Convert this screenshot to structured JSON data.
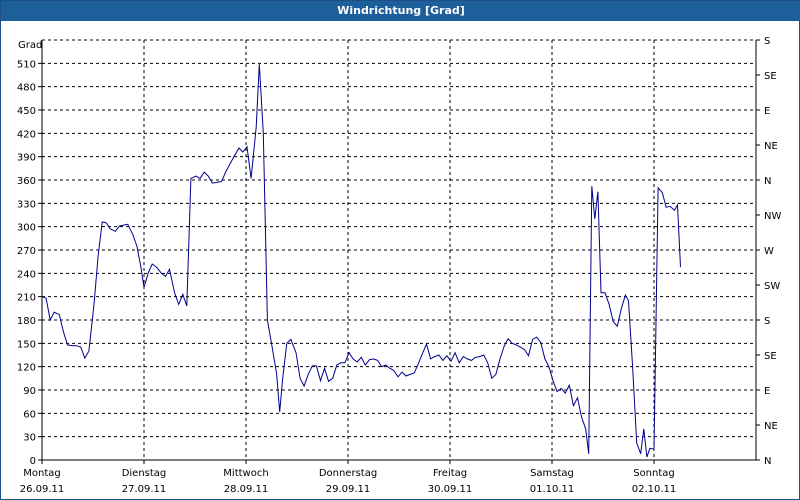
{
  "window": {
    "title": "Windrichtung [Grad]"
  },
  "chart_data": {
    "type": "line",
    "title": "Windrichtung [Grad]",
    "ylabel": "Grad",
    "ylim": [
      0,
      525
    ],
    "yticks": [
      0,
      30,
      60,
      90,
      120,
      150,
      180,
      210,
      240,
      270,
      300,
      330,
      360,
      390,
      420,
      450,
      480,
      510
    ],
    "right_axis_labels": [
      {
        "value": 0,
        "label": "N"
      },
      {
        "value": 45,
        "label": "NE"
      },
      {
        "value": 90,
        "label": "E"
      },
      {
        "value": 135,
        "label": "SE"
      },
      {
        "value": 180,
        "label": "S"
      },
      {
        "value": 225,
        "label": "SW"
      },
      {
        "value": 270,
        "label": "W"
      },
      {
        "value": 315,
        "label": "NW"
      },
      {
        "value": 360,
        "label": "N"
      },
      {
        "value": 405,
        "label": "NE"
      },
      {
        "value": 450,
        "label": "E"
      },
      {
        "value": 495,
        "label": "SE"
      },
      {
        "value": 540,
        "label": "S"
      }
    ],
    "xlim": [
      0,
      7
    ],
    "days": [
      {
        "name": "Montag",
        "date": "26.09.11"
      },
      {
        "name": "Dienstag",
        "date": "27.09.11"
      },
      {
        "name": "Mittwoch",
        "date": "28.09.11"
      },
      {
        "name": "Donnerstag",
        "date": "29.09.11"
      },
      {
        "name": "Freitag",
        "date": "30.09.11"
      },
      {
        "name": "Samstag",
        "date": "01.10.11"
      },
      {
        "name": "Sonntag",
        "date": "02.10.11"
      }
    ],
    "grid": true,
    "line_color": "#00008b",
    "series": [
      {
        "values": [
          [
            0.0,
            210
          ],
          [
            0.04,
            208
          ],
          [
            0.08,
            180
          ],
          [
            0.12,
            190
          ],
          [
            0.17,
            187
          ],
          [
            0.21,
            165
          ],
          [
            0.25,
            148
          ],
          [
            0.3,
            147
          ],
          [
            0.34,
            147
          ],
          [
            0.38,
            145
          ],
          [
            0.42,
            131
          ],
          [
            0.46,
            140
          ],
          [
            0.51,
            200
          ],
          [
            0.55,
            262
          ],
          [
            0.59,
            306
          ],
          [
            0.63,
            305
          ],
          [
            0.67,
            297
          ],
          [
            0.72,
            294
          ],
          [
            0.76,
            301
          ],
          [
            0.8,
            302
          ],
          [
            0.84,
            303
          ],
          [
            0.89,
            290
          ],
          [
            0.93,
            275
          ],
          [
            0.97,
            248
          ],
          [
            1.0,
            222
          ],
          [
            1.04,
            240
          ],
          [
            1.08,
            252
          ],
          [
            1.13,
            247
          ],
          [
            1.17,
            240
          ],
          [
            1.21,
            236
          ],
          [
            1.25,
            245
          ],
          [
            1.3,
            215
          ],
          [
            1.34,
            200
          ],
          [
            1.38,
            213
          ],
          [
            1.42,
            198
          ],
          [
            1.46,
            362
          ],
          [
            1.51,
            365
          ],
          [
            1.55,
            362
          ],
          [
            1.59,
            370
          ],
          [
            1.63,
            365
          ],
          [
            1.67,
            356
          ],
          [
            1.72,
            357
          ],
          [
            1.76,
            358
          ],
          [
            1.8,
            370
          ],
          [
            1.84,
            380
          ],
          [
            1.89,
            392
          ],
          [
            1.93,
            401
          ],
          [
            1.97,
            396
          ],
          [
            2.01,
            403
          ],
          [
            2.05,
            362
          ],
          [
            2.1,
            428
          ],
          [
            2.13,
            509
          ],
          [
            2.17,
            420
          ],
          [
            2.21,
            180
          ],
          [
            2.25,
            150
          ],
          [
            2.3,
            111
          ],
          [
            2.33,
            62
          ],
          [
            2.36,
            105
          ],
          [
            2.4,
            150
          ],
          [
            2.44,
            155
          ],
          [
            2.49,
            138
          ],
          [
            2.53,
            105
          ],
          [
            2.57,
            95
          ],
          [
            2.61,
            110
          ],
          [
            2.65,
            121
          ],
          [
            2.69,
            121
          ],
          [
            2.73,
            102
          ],
          [
            2.77,
            118
          ],
          [
            2.81,
            101
          ],
          [
            2.85,
            105
          ],
          [
            2.89,
            122
          ],
          [
            2.93,
            125
          ],
          [
            2.97,
            125
          ],
          [
            3.01,
            138
          ],
          [
            3.05,
            130
          ],
          [
            3.09,
            126
          ],
          [
            3.13,
            132
          ],
          [
            3.17,
            122
          ],
          [
            3.21,
            129
          ],
          [
            3.25,
            130
          ],
          [
            3.29,
            128
          ],
          [
            3.33,
            120
          ],
          [
            3.37,
            122
          ],
          [
            3.41,
            118
          ],
          [
            3.45,
            115
          ],
          [
            3.49,
            107
          ],
          [
            3.53,
            113
          ],
          [
            3.57,
            108
          ],
          [
            3.61,
            110
          ],
          [
            3.65,
            112
          ],
          [
            3.69,
            124
          ],
          [
            3.73,
            137
          ],
          [
            3.77,
            149
          ],
          [
            3.81,
            130
          ],
          [
            3.85,
            133
          ],
          [
            3.89,
            135
          ],
          [
            3.93,
            128
          ],
          [
            3.97,
            134
          ],
          [
            4.01,
            127
          ],
          [
            4.05,
            138
          ],
          [
            4.09,
            125
          ],
          [
            4.13,
            133
          ],
          [
            4.17,
            130
          ],
          [
            4.21,
            128
          ],
          [
            4.25,
            132
          ],
          [
            4.29,
            133
          ],
          [
            4.33,
            135
          ],
          [
            4.37,
            125
          ],
          [
            4.41,
            105
          ],
          [
            4.45,
            110
          ],
          [
            4.49,
            130
          ],
          [
            4.53,
            146
          ],
          [
            4.57,
            156
          ],
          [
            4.61,
            150
          ],
          [
            4.65,
            148
          ],
          [
            4.69,
            145
          ],
          [
            4.73,
            142
          ],
          [
            4.77,
            134
          ],
          [
            4.81,
            155
          ],
          [
            4.85,
            158
          ],
          [
            4.89,
            151
          ],
          [
            4.93,
            130
          ],
          [
            4.97,
            120
          ],
          [
            5.01,
            102
          ],
          [
            5.05,
            88
          ],
          [
            5.09,
            92
          ],
          [
            5.13,
            86
          ],
          [
            5.17,
            96
          ],
          [
            5.21,
            70
          ],
          [
            5.25,
            80
          ],
          [
            5.29,
            55
          ],
          [
            5.33,
            40
          ],
          [
            5.36,
            8
          ],
          [
            5.39,
            352
          ],
          [
            5.42,
            310
          ],
          [
            5.45,
            345
          ],
          [
            5.48,
            215
          ],
          [
            5.52,
            215
          ],
          [
            5.56,
            200
          ],
          [
            5.6,
            178
          ],
          [
            5.64,
            172
          ],
          [
            5.68,
            195
          ],
          [
            5.72,
            212
          ],
          [
            5.75,
            205
          ],
          [
            5.79,
            120
          ],
          [
            5.83,
            22
          ],
          [
            5.87,
            8
          ],
          [
            5.9,
            40
          ],
          [
            5.93,
            4
          ],
          [
            5.96,
            15
          ],
          [
            6.0,
            14
          ],
          [
            6.04,
            350
          ],
          [
            6.08,
            344
          ],
          [
            6.12,
            325
          ],
          [
            6.16,
            326
          ],
          [
            6.2,
            321
          ],
          [
            6.23,
            328
          ],
          [
            6.26,
            248
          ]
        ]
      }
    ]
  }
}
